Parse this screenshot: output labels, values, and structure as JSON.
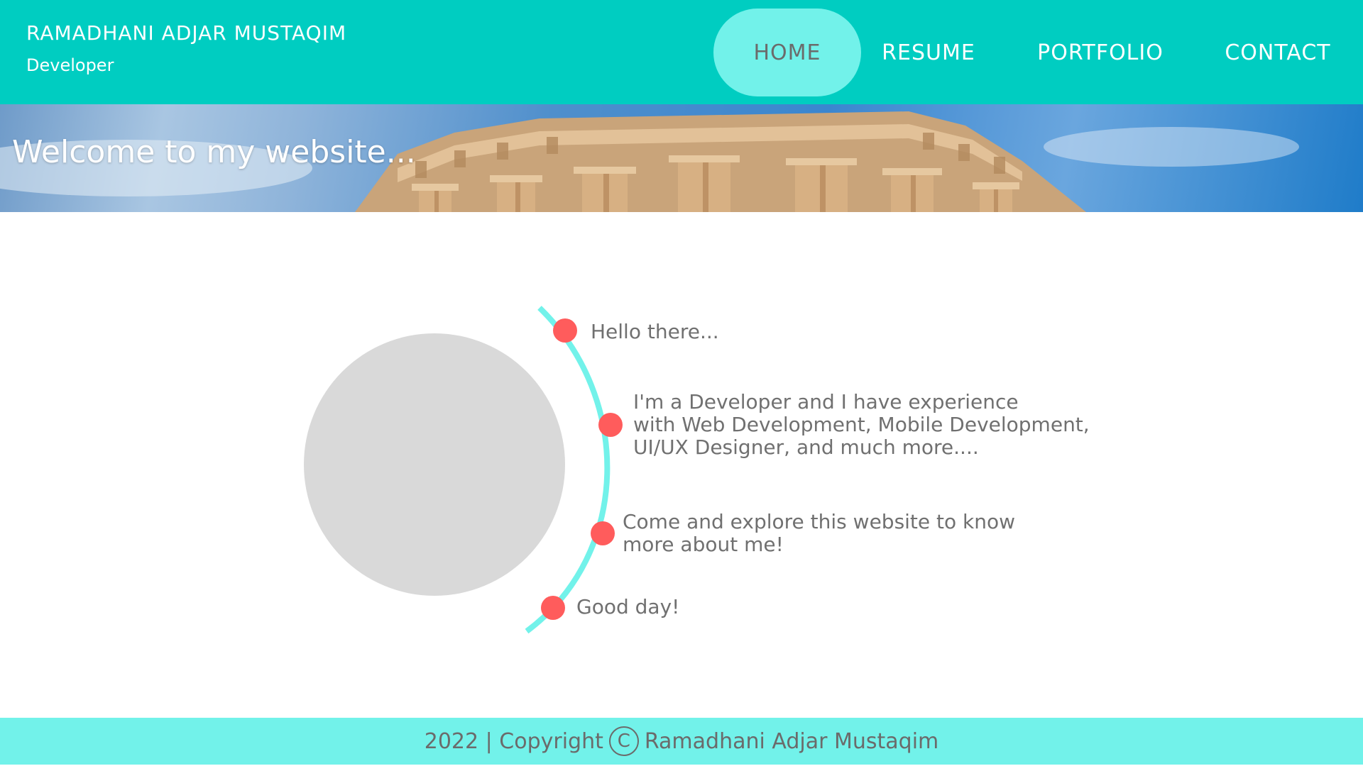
{
  "header": {
    "name": "RAMADHANI ADJAR MUSTAQIM",
    "role": "Developer",
    "nav": [
      {
        "label": "HOME",
        "active": true
      },
      {
        "label": "RESUME",
        "active": false
      },
      {
        "label": "PORTFOLIO",
        "active": false
      },
      {
        "label": "CONTACT",
        "active": false
      }
    ]
  },
  "banner": {
    "title": "Welcome to my website..."
  },
  "timeline": {
    "items": [
      {
        "lines": [
          "Hello there..."
        ]
      },
      {
        "lines": [
          "I'm a Developer and I have experience",
          "with Web Development, Mobile Development,",
          "UI/UX Designer, and much more...."
        ]
      },
      {
        "lines": [
          "Come and explore this website to know",
          "more about me!"
        ]
      },
      {
        "lines": [
          "Good day!"
        ]
      }
    ]
  },
  "footer": {
    "year_text": "2022 | Copyright",
    "copyright_symbol": "C",
    "owner": "Ramadhani Adjar Mustaqim"
  },
  "colors": {
    "header_bg": "#00cdc1",
    "accent_light": "#72f2ea",
    "dot": "#ff5c5c",
    "avatar_placeholder": "#d9d9d9",
    "text_gray": "#707070"
  }
}
